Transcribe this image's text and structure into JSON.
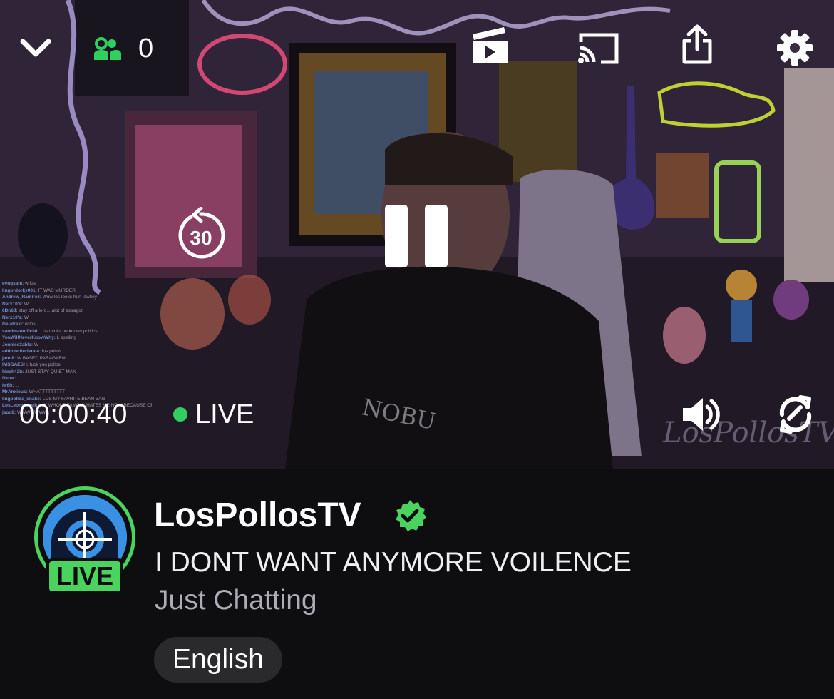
{
  "player": {
    "viewer_count": "0",
    "timecode": "00:00:40",
    "live_label": "LIVE",
    "rewind_seconds": "30",
    "watermark": "LosPollosTV",
    "shirt_text": "NOBU",
    "chat_lines": [
      {
        "user": "evngsam:",
        "text": "w los"
      },
      {
        "user": "lingordorky001:",
        "text": "IT WAS MURDER"
      },
      {
        "user": "Andrew_Ramirez:",
        "text": "Wow los looks hurt lowkey"
      },
      {
        "user": "Nerx10's:",
        "text": "W"
      },
      {
        "user": "6Dn6J:",
        "text": "stay off a lero... alot of estragon"
      },
      {
        "user": "Nerx10's:",
        "text": "W"
      },
      {
        "user": "Gelatrexi:",
        "text": "w los"
      },
      {
        "user": "sandmanofficial:",
        "text": "Los thinks he knows politics"
      },
      {
        "user": "YouWillNeverKnowWhy:",
        "text": "L spelling"
      },
      {
        "user": "Jennies3abla:",
        "text": "W"
      },
      {
        "user": "addictedtoderal4:",
        "text": "los pollos"
      },
      {
        "user": "jaod8:",
        "text": "W BASED PARAGARN"
      },
      {
        "user": "IMSGAESH:",
        "text": "fuck you pollos"
      },
      {
        "user": "hlesh42h:",
        "text": "JUST STAY QUIET MAN"
      },
      {
        "user": "Nkow:",
        "text": "..."
      },
      {
        "user": "hr6h:",
        "text": "..."
      },
      {
        "user": "MrAnxious:",
        "text": "WHATTTTTTTTT"
      },
      {
        "user": "kngpollos_snake:",
        "text": "LOS MY FAVRITE BEAN BAG"
      },
      {
        "user": "LosLeonmebeik:",
        "text": "MY WHOLE FAMOLY HATES ME NOW BECAUSE OF YOU"
      },
      {
        "user": "jaod8:",
        "text": "WWWWWWW"
      }
    ]
  },
  "channel": {
    "name": "LosPollosTV",
    "live_badge": "LIVE",
    "stream_title": "I DONT WANT ANYMORE VOILENCE",
    "category": "Just Chatting",
    "tags": [
      "English"
    ]
  },
  "colors": {
    "live_green": "#4ad35f",
    "viewer_icon_green": "#2fd05f",
    "panel_bg": "#0e0e10",
    "tag_bg": "#2a2a2d",
    "category_gray": "#adadb8"
  },
  "icons": {
    "collapse": "chevron-down-icon",
    "viewers": "viewers-icon",
    "clip": "clip-icon",
    "cast": "cast-icon",
    "share": "share-icon",
    "settings": "gear-icon",
    "rewind": "rewind-30-icon",
    "pause": "pause-icon",
    "volume": "volume-icon",
    "rotate": "rotate-icon",
    "verified": "verified-badge-icon"
  }
}
